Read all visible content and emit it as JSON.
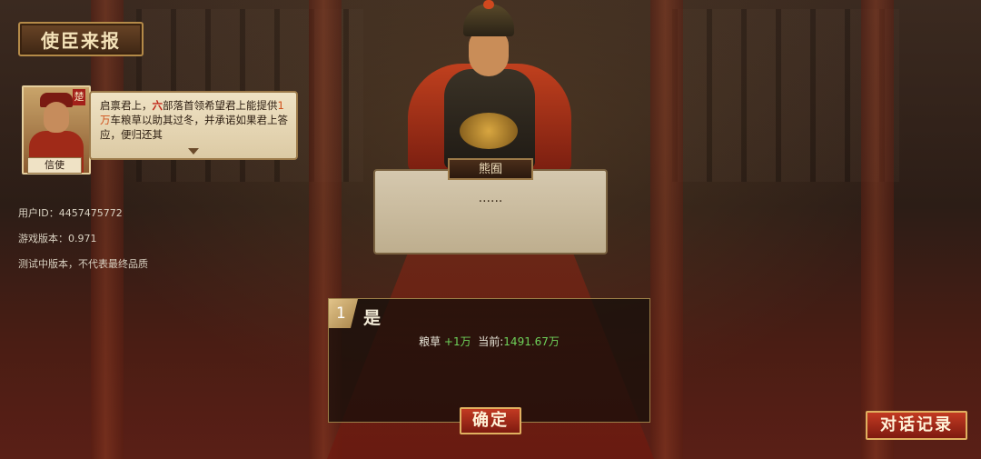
{
  "title": "使臣来报",
  "envoy": {
    "seal": "楚",
    "role": "信使",
    "message_parts": [
      "启禀君上，",
      "六",
      "部落首领希望君上能提供",
      "1万",
      "车粮草以助其过冬，并承诺如果君上答应，便归还其"
    ]
  },
  "info": {
    "user_id": "用户ID：4457475772",
    "version": "游戏版本：0.971",
    "notice": "测试中版本，不代表最终品质"
  },
  "speaker": {
    "name": "熊囿",
    "speech": "......"
  },
  "choice": {
    "number": "1",
    "label": "是",
    "effect_name": "粮草",
    "effect_delta": "+1万",
    "current_label": "当前:",
    "current_value": "1491.67万"
  },
  "buttons": {
    "confirm": "确定",
    "dialogue_log": "对话记录"
  },
  "colors": {
    "accent_red": "#c0281a",
    "positive_green": "#6fd25a",
    "gold_border": "#e0b060"
  }
}
